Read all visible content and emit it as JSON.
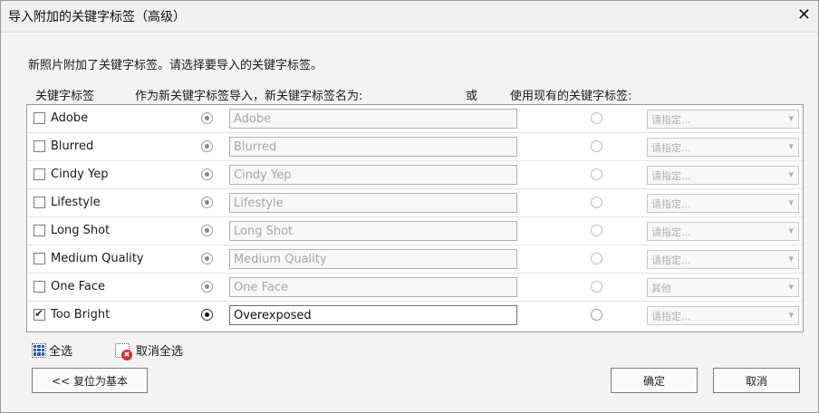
{
  "window": {
    "title": "导入附加的关键字标签（高级）",
    "close": "✕"
  },
  "intro": "新照片附加了关键字标签。请选择要导入的关键字标签。",
  "headers": {
    "tag": "关键字标签",
    "new_tag": "作为新关键字标签导入，新关键字标签名为:",
    "or": "或",
    "existing": "使用现有的关键字标签:"
  },
  "rows": [
    {
      "keyword": "Adobe",
      "checked": false,
      "name": "Adobe",
      "existing": "请指定..."
    },
    {
      "keyword": "Blurred",
      "checked": false,
      "name": "Blurred",
      "existing": "请指定..."
    },
    {
      "keyword": "Cindy Yep",
      "checked": false,
      "name": "Cindy Yep",
      "existing": "请指定..."
    },
    {
      "keyword": "Lifestyle",
      "checked": false,
      "name": "Lifestyle",
      "existing": "请指定..."
    },
    {
      "keyword": "Long Shot",
      "checked": false,
      "name": "Long Shot",
      "existing": "请指定..."
    },
    {
      "keyword": "Medium Quality",
      "checked": false,
      "name": "Medium Quality",
      "existing": "请指定..."
    },
    {
      "keyword": "One Face",
      "checked": false,
      "name": "One Face",
      "existing": "其他"
    },
    {
      "keyword": "Too Bright",
      "checked": true,
      "name": "Overexposed",
      "existing": "请指定..."
    }
  ],
  "links": {
    "select_all": "全选",
    "deselect_all": "取消全选"
  },
  "buttons": {
    "reset": "<< 复位为基本",
    "ok": "确定",
    "cancel": "取消"
  }
}
